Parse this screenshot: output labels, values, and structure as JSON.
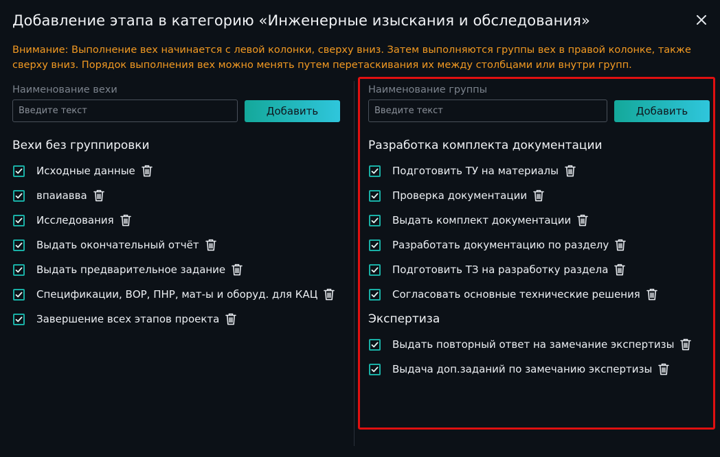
{
  "dialog": {
    "title": "Добавление этапа в категорию «Инженерные изыскания и обследования»",
    "close_icon": "close-icon",
    "warning": "Внимание: Выполнение вех начинается с левой колонки, сверху вниз. Затем выполняются группы вех в правой колонке, также сверху вниз. Порядок выполнения вех можно менять путем перетаскивания их между столбцами или внутри групп.",
    "warning_color": "#f39a22"
  },
  "left": {
    "field_label": "Наименование вехи",
    "placeholder": "Введите текст",
    "add_label": "Добавить",
    "section_title": "Вехи без группировки",
    "items": [
      {
        "label": "Исходные данные",
        "checked": true
      },
      {
        "label": "впаиавва",
        "checked": true
      },
      {
        "label": "Исследования",
        "checked": true
      },
      {
        "label": "Выдать окончательный отчёт",
        "checked": true
      },
      {
        "label": "Выдать предварительное задание",
        "checked": true
      },
      {
        "label": "Спецификации, ВОР, ПНР, мат-ы и оборуд. для КАЦ",
        "checked": true
      },
      {
        "label": "Завершение всех этапов проекта",
        "checked": true
      }
    ]
  },
  "right": {
    "field_label": "Наименование группы",
    "placeholder": "Введите текст",
    "add_label": "Добавить",
    "groups": [
      {
        "title": "Разработка комплекта документации",
        "items": [
          {
            "label": "Подготовить ТУ на материалы",
            "checked": true
          },
          {
            "label": "Проверка документации",
            "checked": true
          },
          {
            "label": "Выдать комплект документации",
            "checked": true
          },
          {
            "label": "Разработать документацию по разделу",
            "checked": true
          },
          {
            "label": "Подготовить ТЗ на разработку раздела",
            "checked": true
          },
          {
            "label": "Согласовать основные технические решения",
            "checked": true
          }
        ]
      },
      {
        "title": "Экспертиза",
        "items": [
          {
            "label": "Выдать повторный ответ на замечание экспертизы",
            "checked": true
          },
          {
            "label": "Выдача доп.заданий по замечанию экспертизы",
            "checked": true
          }
        ]
      }
    ]
  },
  "colors": {
    "accent": "#19b0a6",
    "button_gradient_start": "#14a89a",
    "button_gradient_end": "#2fc6dc",
    "highlight_border": "#e01010",
    "background": "#0c1117"
  },
  "icons": {
    "checkbox": "checkmark-icon",
    "delete": "trash-icon"
  }
}
